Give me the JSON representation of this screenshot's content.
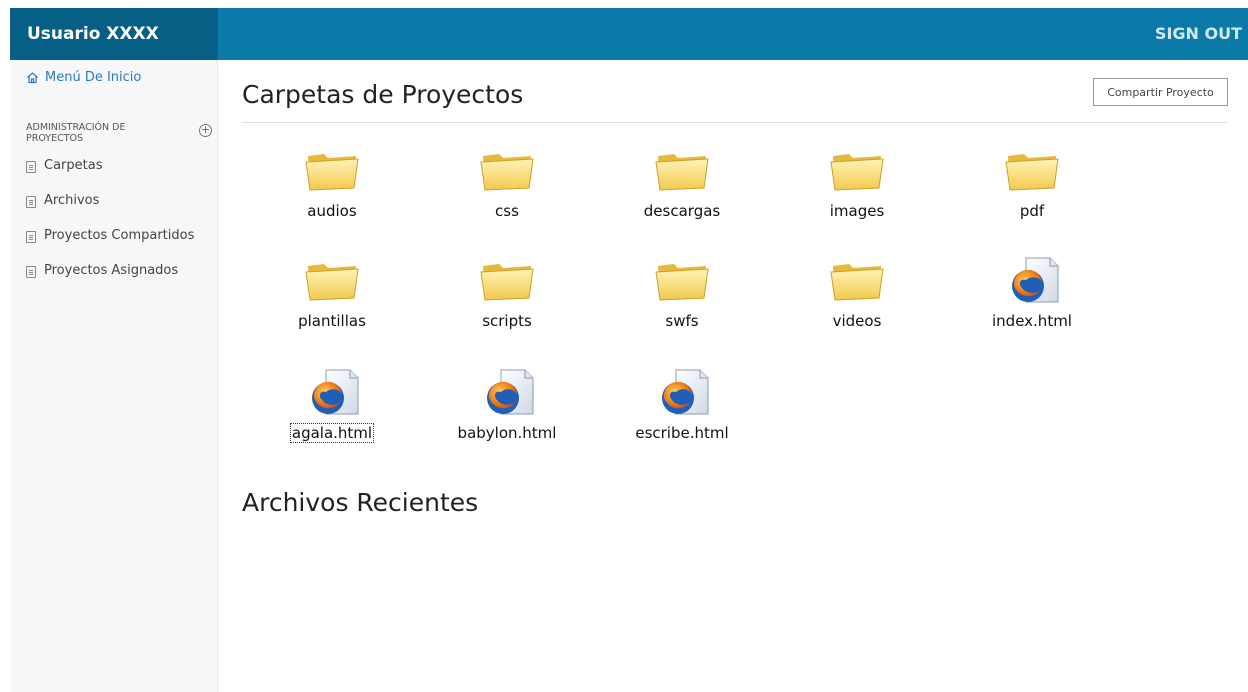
{
  "header": {
    "user": "Usuario XXXX",
    "signout": "SIGN OUT"
  },
  "sidebar": {
    "home": "Menú De Inicio",
    "section_title": "ADMINISTRACIÓN DE PROYECTOS",
    "items": [
      {
        "label": "Carpetas"
      },
      {
        "label": "Archivos"
      },
      {
        "label": "Proyectos Compartidos"
      },
      {
        "label": "Proyectos Asignados"
      }
    ]
  },
  "main": {
    "title": "Carpetas de Proyectos",
    "share_button": "Compartir Proyecto",
    "recent_title": "Archivos Recientes",
    "files": [
      {
        "name": "audios",
        "kind": "folder-icon"
      },
      {
        "name": "css",
        "kind": "folder-icon"
      },
      {
        "name": "descargas",
        "kind": "folder-icon"
      },
      {
        "name": "images",
        "kind": "folder-icon"
      },
      {
        "name": "pdf",
        "kind": "folder-icon"
      },
      {
        "name": "plantillas",
        "kind": "folder-icon"
      },
      {
        "name": "scripts",
        "kind": "folder-icon"
      },
      {
        "name": "swfs",
        "kind": "folder-icon"
      },
      {
        "name": "videos",
        "kind": "folder-icon"
      },
      {
        "name": "index.html",
        "kind": "firefox-html-file-icon"
      },
      {
        "name": "agala.html",
        "kind": "firefox-html-file-icon"
      },
      {
        "name": "babylon.html",
        "kind": "firefox-html-file-icon"
      },
      {
        "name": "escribe.html",
        "kind": "firefox-html-file-icon"
      }
    ]
  }
}
